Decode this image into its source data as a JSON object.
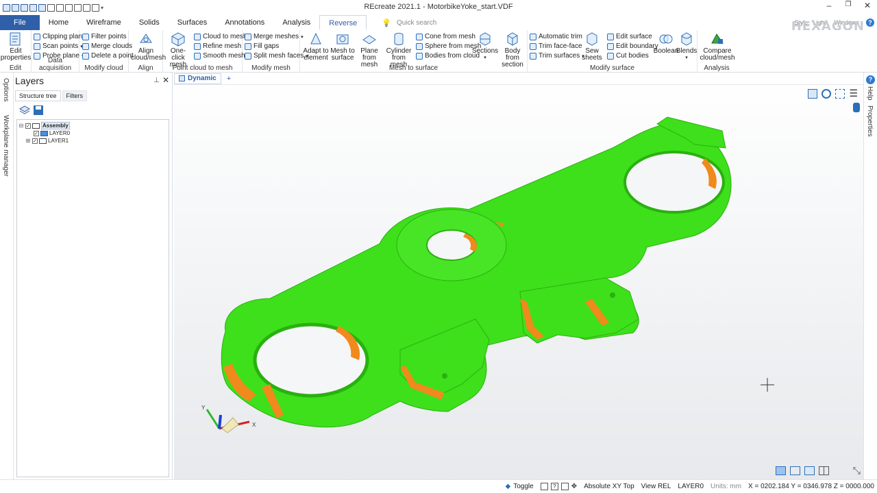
{
  "window": {
    "title": "REcreate 2021.1 - MotorbikeYoke_start.VDF"
  },
  "window_controls": {
    "minimize": "–",
    "restore": "❐",
    "close": "✕"
  },
  "tabs": [
    {
      "label": "File"
    },
    {
      "label": "Home"
    },
    {
      "label": "Wireframe"
    },
    {
      "label": "Solids"
    },
    {
      "label": "Surfaces"
    },
    {
      "label": "Annotations"
    },
    {
      "label": "Analysis"
    },
    {
      "label": "Reverse"
    }
  ],
  "quick_search": {
    "placeholder": "Quick search"
  },
  "top_right": {
    "style": "Style: 'Light'",
    "windows": "Windows",
    "brand": "HEXAGON"
  },
  "ribbon": {
    "edit": {
      "caption": "Edit",
      "properties": "Edit properties"
    },
    "data_acquisition": {
      "caption": "Data acquisition",
      "clipping_plane": "Clipping plane",
      "scan_points": "Scan points",
      "probe_plane": "Probe plane"
    },
    "modify_cloud": {
      "caption": "Modify cloud",
      "filter_points": "Filter points",
      "merge_clouds": "Merge clouds",
      "delete_point": "Delete a point"
    },
    "align": {
      "caption": "Align",
      "align_cloud_mesh": "Align cloud/mesh"
    },
    "point_cloud_to_mesh": {
      "caption": "Point cloud to mesh",
      "one_click_mesh": "One-click mesh",
      "cloud_to_mesh": "Cloud to mesh",
      "refine_mesh": "Refine mesh",
      "smooth_mesh": "Smooth mesh"
    },
    "modify_mesh": {
      "caption": "Modify mesh",
      "merge_meshes": "Merge meshes",
      "fill_gaps": "Fill gaps",
      "split_mesh_faces": "Split mesh faces"
    },
    "mesh_to_surface": {
      "caption": "Mesh to surface",
      "adapt_to_element": "Adapt to element",
      "mesh_to_surface": "Mesh to surface",
      "plane_from_mesh": "Plane from mesh",
      "cylinder_from_mesh": "Cylinder from mesh",
      "cone_from_mesh": "Cone from mesh",
      "sphere_from_mesh": "Sphere from mesh",
      "bodies_from_cloud": "Bodies from cloud",
      "sections": "Sections",
      "body_from_section": "Body from section"
    },
    "modify_surface": {
      "caption": "Modify surface",
      "automatic_trim": "Automatic trim",
      "trim_face_face": "Trim face-face",
      "trim_surfaces": "Trim surfaces",
      "sew_sheets": "Sew sheets",
      "edit_surface": "Edit surface",
      "edit_boundary": "Edit boundary",
      "cut_bodies": "Cut bodies",
      "boolean": "Boolean",
      "blends": "Blends"
    },
    "analysis": {
      "caption": "Analysis",
      "compare": "Compare cloud/mesh"
    }
  },
  "left_strip": {
    "options": "Options",
    "workplane": "Workplane manager"
  },
  "layers": {
    "title": "Layers",
    "tabs": [
      "Structure tree",
      "Filters"
    ],
    "tree": [
      {
        "label": "Assembly",
        "level": 0,
        "checked": true,
        "expanded": true
      },
      {
        "label": "LAYER0",
        "level": 1,
        "checked": true
      },
      {
        "label": "LAYER1",
        "level": 1,
        "checked": true,
        "collapsed": true
      }
    ]
  },
  "viewport": {
    "tab": "Dynamic",
    "add_tab": "+",
    "axes": {
      "x": "X",
      "y": "Y"
    }
  },
  "right_strip": {
    "help": "Help",
    "properties": "Properties"
  },
  "status": {
    "toggle": "Toggle",
    "view": "Absolute XY Top",
    "viewref": "View REL",
    "layer": "LAYER0",
    "units": "Units: mm",
    "coords": "X = 0202.184  Y = 0346.978  Z = 0000.000"
  },
  "colors": {
    "accent": "#2f5fa8",
    "mesh_green": "#3de01a",
    "mesh_orange": "#f08a1c"
  }
}
